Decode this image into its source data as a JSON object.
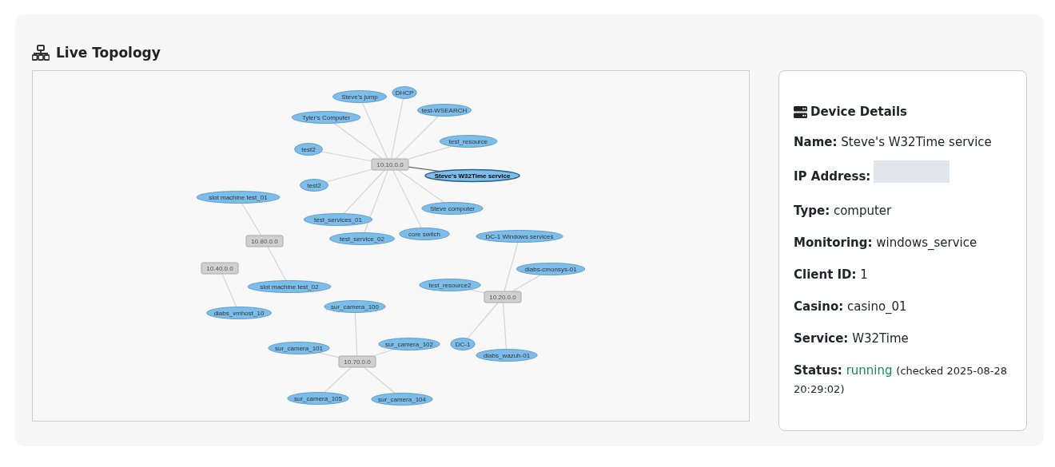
{
  "panel": {
    "title": "Live Topology"
  },
  "topology": {
    "subnets": [
      {
        "label": "10.10.0.0",
        "hosts": [
          {
            "label": "Steve's jump",
            "selected": false
          },
          {
            "label": "DHCP",
            "selected": false
          },
          {
            "label": "test-WSEARCH",
            "selected": false
          },
          {
            "label": "Tyler's Computer",
            "selected": false
          },
          {
            "label": "test_resource",
            "selected": false
          },
          {
            "label": "test2",
            "selected": false
          },
          {
            "label": "Steve's W32Time service",
            "selected": true
          },
          {
            "label": "test2",
            "selected": false
          },
          {
            "label": "Steve computer",
            "selected": false
          },
          {
            "label": "test_services_01",
            "selected": false
          },
          {
            "label": "test_service_02",
            "selected": false
          },
          {
            "label": "core switch",
            "selected": false
          }
        ]
      },
      {
        "label": "10.80.0.0",
        "hosts": [
          {
            "label": "slot machine test_01",
            "selected": false
          },
          {
            "label": "slot machine test_02",
            "selected": false
          }
        ]
      },
      {
        "label": "10.40.0.0",
        "hosts": [
          {
            "label": "diabs_vmhost_10",
            "selected": false
          }
        ]
      },
      {
        "label": "10.20.0.0",
        "hosts": [
          {
            "label": "DC-1 Windows services",
            "selected": false
          },
          {
            "label": "diabs-cmonsys-01",
            "selected": false
          },
          {
            "label": "test_resource2",
            "selected": false
          },
          {
            "label": "DC-1",
            "selected": false
          },
          {
            "label": "diabs_wazuh-01",
            "selected": false
          }
        ]
      },
      {
        "label": "10.70.0.0",
        "hosts": [
          {
            "label": "sur_camera_100",
            "selected": false
          },
          {
            "label": "sur_camera_101",
            "selected": false
          },
          {
            "label": "sur_camera_102",
            "selected": false
          },
          {
            "label": "sur_camera_105",
            "selected": false
          },
          {
            "label": "sur_camera_104",
            "selected": false
          }
        ]
      }
    ]
  },
  "details": {
    "title": "Device Details",
    "fields": [
      {
        "kind": "text",
        "label": "Name:",
        "value": "Steve's W32Time service"
      },
      {
        "kind": "redacted",
        "label": "IP Address:"
      },
      {
        "kind": "text",
        "label": "Type:",
        "value": "computer"
      },
      {
        "kind": "text",
        "label": "Monitoring:",
        "value": "windows_service"
      },
      {
        "kind": "text",
        "label": "Client ID:",
        "value": "1"
      },
      {
        "kind": "text",
        "label": "Casino:",
        "value": "casino_01"
      },
      {
        "kind": "text",
        "label": "Service:",
        "value": "W32Time"
      },
      {
        "kind": "status",
        "label": "Status:",
        "value": "running",
        "note": "(checked 2025-08-28 20:29:02)"
      }
    ]
  }
}
